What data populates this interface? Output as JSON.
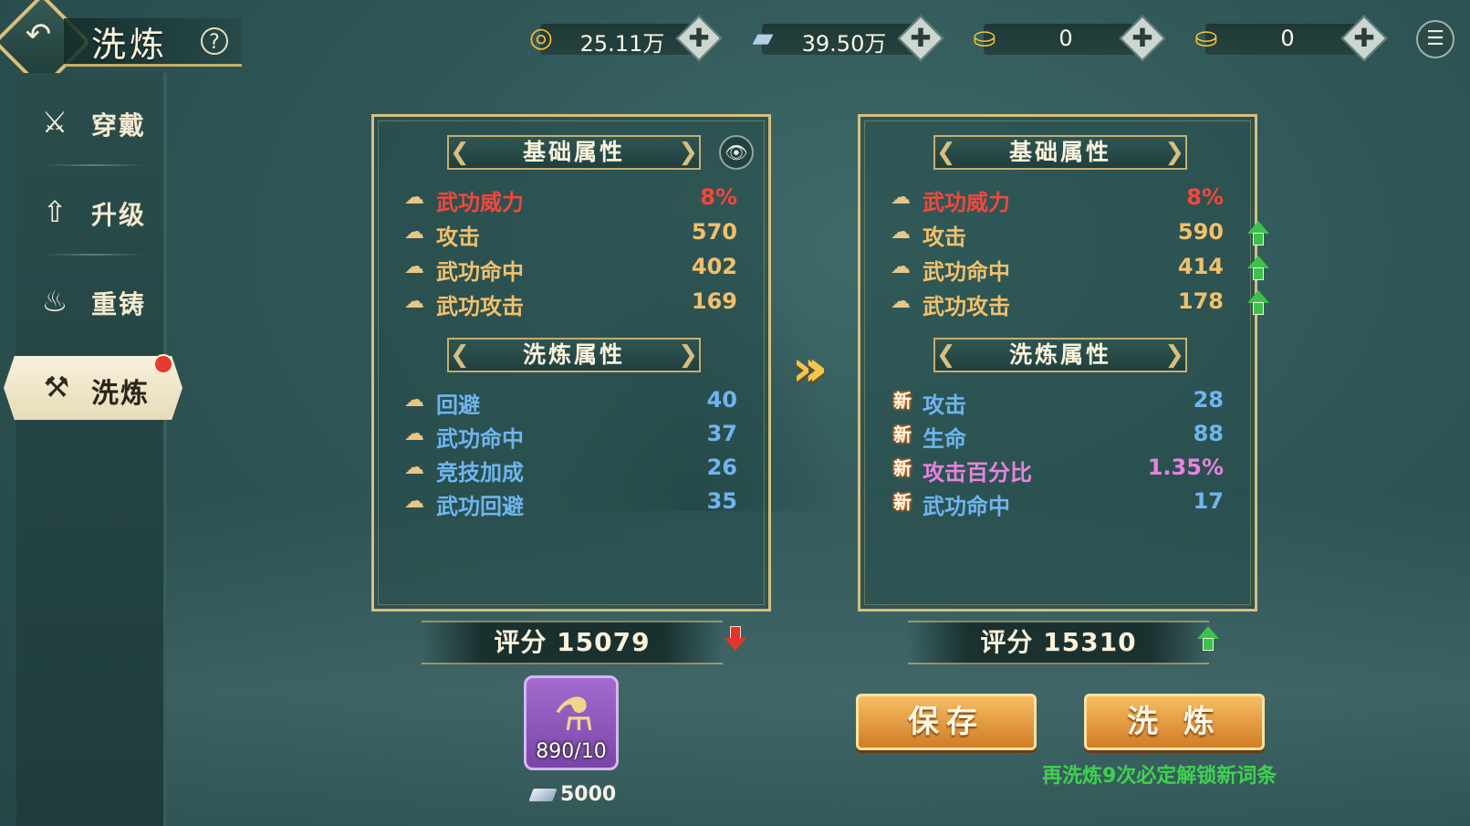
{
  "header": {
    "title": "洗炼",
    "help": "?",
    "back_glyph": "↶"
  },
  "currencies": [
    {
      "icon": "copper-coin-icon",
      "glyph": "◎",
      "value": "25.11万"
    },
    {
      "icon": "silver-ingot-icon",
      "glyph": "▰",
      "value": "39.50万"
    },
    {
      "icon": "bound-gold-ingot-icon",
      "glyph": "⛀",
      "value": "0"
    },
    {
      "icon": "gold-ingot-icon",
      "glyph": "⛀",
      "value": "0"
    }
  ],
  "add_glyph": "✚",
  "menu_glyph": "☰",
  "sidebar": {
    "items": [
      {
        "label": "穿戴",
        "glyph": "⚔"
      },
      {
        "label": "升级",
        "glyph": "⇧"
      },
      {
        "label": "重铸",
        "glyph": "♨"
      },
      {
        "label": "洗炼",
        "glyph": "⚒"
      }
    ]
  },
  "left_panel": {
    "base_title": "基础属性",
    "refine_title": "洗炼属性",
    "eye_glyph": "👁",
    "base": [
      {
        "name": "武功威力",
        "value": "8%",
        "color": "red"
      },
      {
        "name": "攻击",
        "value": "570",
        "color": "orange"
      },
      {
        "name": "武功命中",
        "value": "402",
        "color": "orange"
      },
      {
        "name": "武功攻击",
        "value": "169",
        "color": "orange"
      }
    ],
    "refine": [
      {
        "name": "回避",
        "value": "40"
      },
      {
        "name": "武功命中",
        "value": "37"
      },
      {
        "name": "竞技加成",
        "value": "26"
      },
      {
        "name": "武功回避",
        "value": "35"
      }
    ],
    "score": "评分 15079"
  },
  "right_panel": {
    "base_title": "基础属性",
    "refine_title": "洗炼属性",
    "base": [
      {
        "name": "武功威力",
        "value": "8%"
      },
      {
        "name": "攻击",
        "value": "590"
      },
      {
        "name": "武功命中",
        "value": "414"
      },
      {
        "name": "武功攻击",
        "value": "178"
      }
    ],
    "refine": [
      {
        "badge": "新",
        "name": "攻击",
        "value": "28",
        "color": "blue"
      },
      {
        "badge": "新",
        "name": "生命",
        "value": "88",
        "color": "blue"
      },
      {
        "badge": "新",
        "name": "攻击百分比",
        "value": "1.35%",
        "color": "pink"
      },
      {
        "badge": "新",
        "name": "武功命中",
        "value": "17",
        "color": "blue"
      }
    ],
    "score": "评分 15310"
  },
  "item": {
    "count": "890/10",
    "cost": "5000"
  },
  "buttons": {
    "save": "保存",
    "refine": "洗 炼"
  },
  "hint": "再洗炼9次必定解锁新词条",
  "colors": {
    "red": "#f0483e",
    "orange": "#f2c06c",
    "blue": "#6fb5ee",
    "pink": "#e882e0",
    "green": "#3fd14f",
    "gold_border": "#d6bf7f"
  }
}
